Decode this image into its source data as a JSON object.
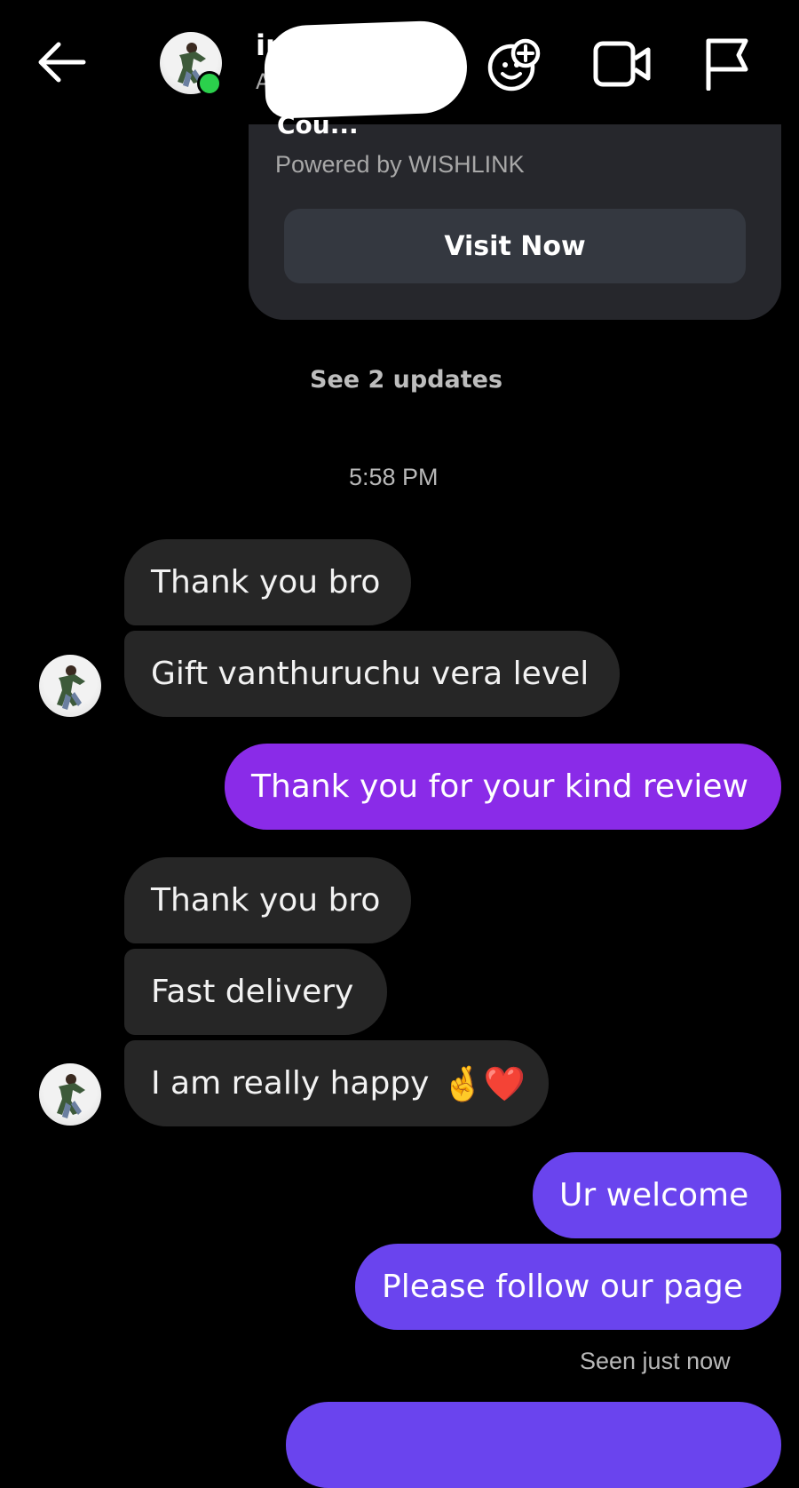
{
  "header": {
    "name_visible": "in",
    "subtitle_visible": "A",
    "back_icon": "arrow-left-icon",
    "effects_icon": "sticker-add-icon",
    "video_icon": "video-camera-icon",
    "report_icon": "flag-icon",
    "online_color": "#2bd14c"
  },
  "card": {
    "title_partial": "Cou...",
    "powered_by": "Powered by WISHLINK",
    "button_label": "Visit Now"
  },
  "see_updates": "See 2 updates",
  "timestamp": "5:58 PM",
  "messages": [
    {
      "from": "them",
      "text": "Thank you bro"
    },
    {
      "from": "them",
      "text": "Gift vanthuruchu vera level"
    },
    {
      "from": "me",
      "text": "Thank you for your kind review"
    },
    {
      "from": "them",
      "text": "Thank you bro"
    },
    {
      "from": "them",
      "text": "Fast delivery"
    },
    {
      "from": "them",
      "text": "I am really happy",
      "emoji": "🤞❤️"
    },
    {
      "from": "me",
      "text": "Ur welcome"
    },
    {
      "from": "me",
      "text": "Please follow our page"
    }
  ],
  "seen_status": "Seen just now",
  "colors": {
    "background": "#000000",
    "incoming_bubble": "#262626",
    "outgoing_bubble_purple": "#8a2be8",
    "outgoing_bubble_violet": "#6a44ee"
  }
}
